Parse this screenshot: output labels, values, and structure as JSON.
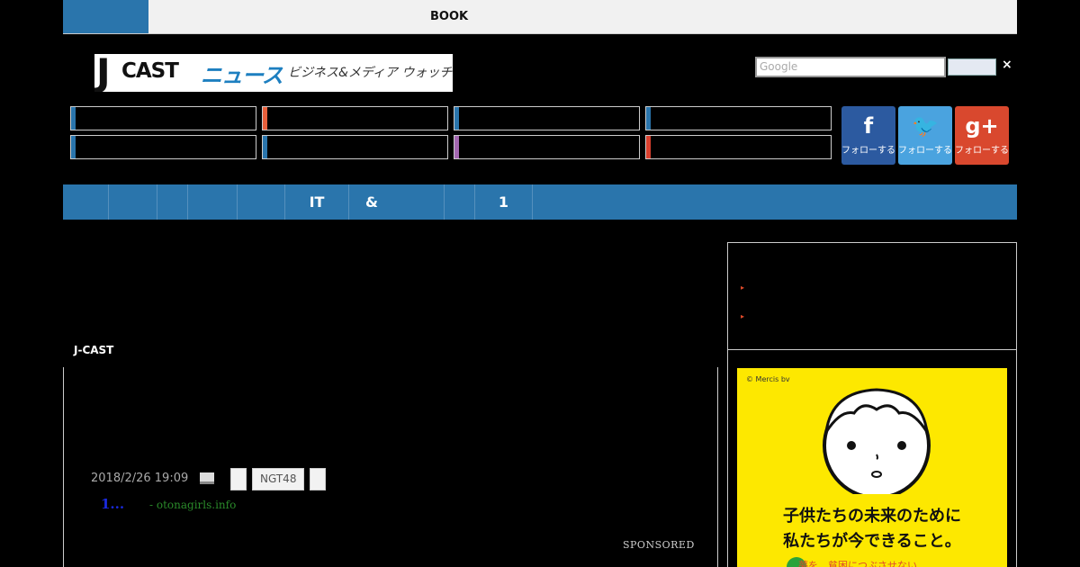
{
  "topbar": {
    "book_label": "BOOK"
  },
  "logo": {
    "j": "J",
    "cast": "CAST",
    "news": "ニュース",
    "tagline": "ビジネス&メディア ウォッチ"
  },
  "search": {
    "placeholder": "Google",
    "close": "×"
  },
  "categories": {
    "accent_colors": [
      "#2a75ac",
      "#e8603c",
      "#2a75ac",
      "#2a75ac",
      "#2a75ac",
      "#2a75ac",
      "#a367b0",
      "#d9402e"
    ]
  },
  "social": [
    {
      "icon": "f",
      "label": "フォローする",
      "color": "#2c5aa0"
    },
    {
      "icon": "🐦",
      "label": "フォローする",
      "color": "#4aa3df"
    },
    {
      "icon": "g+",
      "label": "フォローする",
      "color": "#d9482e"
    }
  ],
  "nav": {
    "items": [
      "",
      "",
      "",
      "",
      "",
      "IT",
      "&",
      "",
      "1",
      ""
    ]
  },
  "sidebar": {
    "arrows": [
      "▸",
      "▸"
    ]
  },
  "ad": {
    "copyright": "© Mercis bv",
    "line1": "子供たちの未来のために",
    "line2": "私たちが今できること。",
    "sub": "夢を、貧困につぶさせない"
  },
  "main": {
    "section_label": "J-CAST",
    "date": "2018/2/26 19:09",
    "tag_ngt": "NGT48",
    "sponsor_title": "1...",
    "sponsor_source": "- otonagirls.info",
    "sponsored_label": "SPONSORED"
  }
}
